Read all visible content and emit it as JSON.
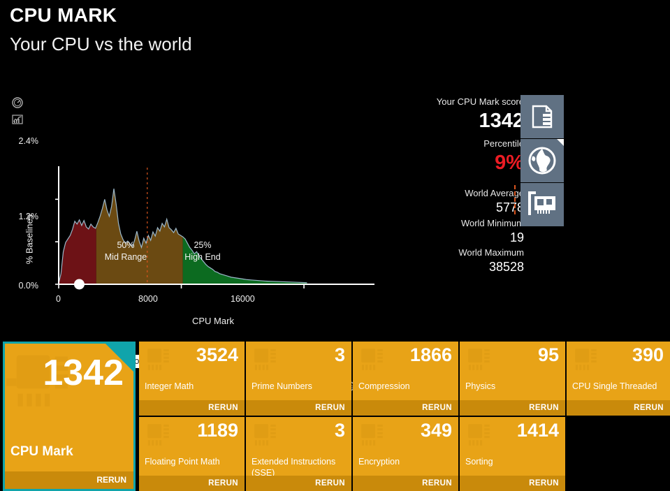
{
  "header": {
    "title": "CPU MARK",
    "subtitle": "Your CPU vs the world"
  },
  "rail": {
    "gauge_icon": "gauge-icon",
    "chart_icon": "chart-icon"
  },
  "stats": {
    "score_label": "Your CPU Mark score",
    "score_value": "1342",
    "percentile_label": "Percentile",
    "percentile_value": "9%",
    "world_average_label": "World Average",
    "world_average_value": "5778",
    "world_minimum_label": "World Minimum",
    "world_minimum_value": "19",
    "world_maximum_label": "World Maximum",
    "world_maximum_value": "38528",
    "icons": [
      "baseline-document-icon",
      "globe-icon",
      "expansion-card-icon"
    ],
    "percentile_color": "#ec1c24",
    "icon_tile_color": "#607183"
  },
  "chart_controls": {
    "zoom_out": "zoom-out-icon",
    "zoom_in": "zoom-in-icon",
    "zoom_fit": "zoom-fit-icon",
    "zoom_reset": "zoom-reset-icon"
  },
  "chart_data": {
    "type": "area",
    "title": "",
    "xlabel": "CPU Mark",
    "ylabel": "% Baselines",
    "xlim": [
      0,
      20600
    ],
    "ylim": [
      0.0,
      2.9
    ],
    "xticks": [
      "0",
      "8000",
      "16000"
    ],
    "xtick_values": [
      0,
      8000,
      16000
    ],
    "yticks": [
      "0.0%",
      "1.2%",
      "2.4%"
    ],
    "ytick_values": [
      0.0,
      1.2,
      2.4
    ],
    "grid": false,
    "legend": "none",
    "marker": {
      "label": "Your CPU Mark score: 1342",
      "x": 1342,
      "y": 0.0
    },
    "average_line": {
      "value": 5778,
      "style": "dotted",
      "color": "#d9541e"
    },
    "bands": [
      {
        "name": "low-end",
        "color": "#6d1216",
        "x_start": 0,
        "x_end": 2450,
        "label": "",
        "sublabel": ""
      },
      {
        "name": "mid-range",
        "color": "#6b4a12",
        "x_start": 2450,
        "x_end": 8100,
        "label": "50%",
        "sublabel": "Mid Range"
      },
      {
        "name": "high-end",
        "color": "#0c6b20",
        "x_start": 8100,
        "x_end": 16300,
        "label": "25%",
        "sublabel": "High End"
      }
    ],
    "line_color": "#9bb7c9",
    "x": [
      0,
      150,
      300,
      450,
      600,
      750,
      900,
      1050,
      1200,
      1350,
      1500,
      1650,
      1800,
      1950,
      2100,
      2250,
      2400,
      2550,
      2700,
      2850,
      3000,
      3150,
      3300,
      3450,
      3600,
      3750,
      3900,
      4050,
      4200,
      4350,
      4500,
      4650,
      4800,
      4950,
      5100,
      5250,
      5400,
      5550,
      5700,
      5850,
      6000,
      6150,
      6300,
      6450,
      6600,
      6750,
      6900,
      7050,
      7200,
      7350,
      7500,
      7650,
      7800,
      7950,
      8100,
      8250,
      8400,
      8550,
      8700,
      8850,
      9000,
      9150,
      9300,
      9450,
      9600,
      9750,
      9900,
      10050,
      10200,
      10350,
      10500,
      10650,
      10800,
      10950,
      11100,
      11250,
      11400,
      11550,
      11700,
      11850,
      12000,
      12300,
      12600,
      12900,
      13200,
      13500,
      13800,
      14100,
      14400,
      14700,
      15000,
      15300,
      15600,
      15900,
      16200
    ],
    "values": [
      0.02,
      0.3,
      0.92,
      1.18,
      1.28,
      1.38,
      1.55,
      1.78,
      1.7,
      1.82,
      1.66,
      1.8,
      1.62,
      1.56,
      1.7,
      1.62,
      1.58,
      1.74,
      1.92,
      2.14,
      2.4,
      2.1,
      1.92,
      2.2,
      2.7,
      2.26,
      1.72,
      1.42,
      1.26,
      1.16,
      1.22,
      1.14,
      1.06,
      1.24,
      1.5,
      1.22,
      1.04,
      1.3,
      1.16,
      1.38,
      1.24,
      1.48,
      1.36,
      1.6,
      1.5,
      1.72,
      1.62,
      1.84,
      1.6,
      1.54,
      1.46,
      1.58,
      1.42,
      1.38,
      1.34,
      1.28,
      1.16,
      1.04,
      0.96,
      0.86,
      0.92,
      0.8,
      0.72,
      0.64,
      0.56,
      0.5,
      0.46,
      0.42,
      0.36,
      0.34,
      0.3,
      0.28,
      0.26,
      0.24,
      0.22,
      0.2,
      0.19,
      0.18,
      0.17,
      0.16,
      0.15,
      0.13,
      0.12,
      0.11,
      0.1,
      0.09,
      0.085,
      0.08,
      0.075,
      0.07,
      0.065,
      0.06,
      0.055,
      0.05,
      0.045
    ]
  },
  "tiles": {
    "main": {
      "score": "1342",
      "name": "CPU Mark",
      "rerun_label": "RERUN",
      "selected": true,
      "accent_color": "#10a4ab"
    },
    "items": [
      {
        "score": "3524",
        "name": "Integer Math",
        "rerun_label": "RERUN"
      },
      {
        "score": "3",
        "name": "Prime Numbers",
        "rerun_label": "RERUN"
      },
      {
        "score": "1866",
        "name": "Compression",
        "rerun_label": "RERUN"
      },
      {
        "score": "95",
        "name": "Physics",
        "rerun_label": "RERUN"
      },
      {
        "score": "390",
        "name": "CPU Single Threaded",
        "rerun_label": "RERUN"
      },
      {
        "score": "1189",
        "name": "Floating Point Math",
        "rerun_label": "RERUN"
      },
      {
        "score": "3",
        "name": "Extended Instructions (SSE)",
        "rerun_label": "RERUN"
      },
      {
        "score": "349",
        "name": "Encryption",
        "rerun_label": "RERUN"
      },
      {
        "score": "1414",
        "name": "Sorting",
        "rerun_label": "RERUN"
      }
    ],
    "tile_color": "#e8a317",
    "rerun_bar_color": "#c98a0b"
  }
}
